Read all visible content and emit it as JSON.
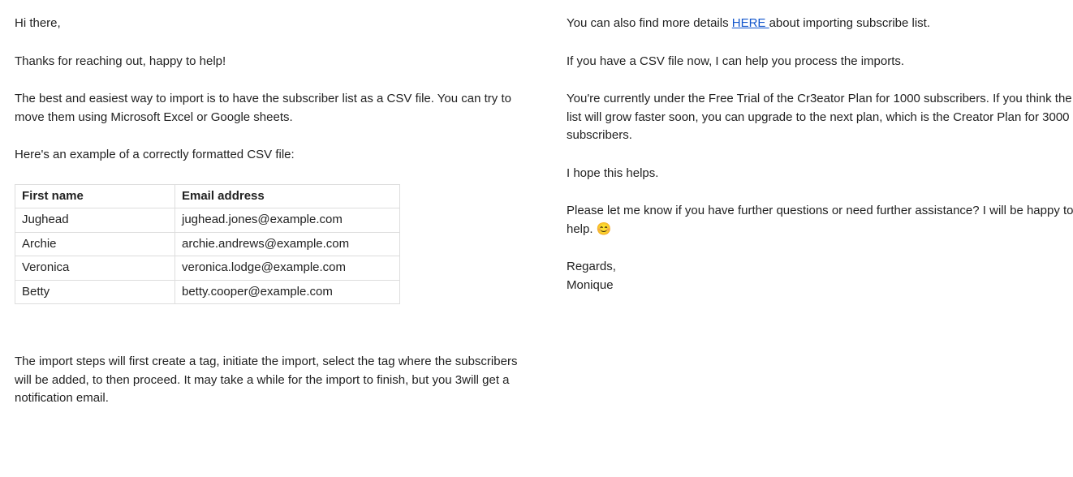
{
  "left": {
    "greeting": "Hi there,",
    "thanks": "Thanks for reaching out, happy to help!",
    "bestway": "The best and easiest way to import is to have the subscriber list as a CSV file. You can try to move them using Microsoft Excel or Google sheets.",
    "example_intro": "Here's an example of a correctly formatted CSV file:",
    "table": {
      "headers": [
        "First name",
        "Email address"
      ],
      "rows": [
        [
          "Jughead",
          "jughead.jones@example.com"
        ],
        [
          "Archie",
          "archie.andrews@example.com"
        ],
        [
          "Veronica",
          "veronica.lodge@example.com"
        ],
        [
          "Betty",
          "betty.cooper@example.com"
        ]
      ]
    },
    "importsteps": "The import steps will first create a tag, initiate the import, select the tag where the subscribers will be added, to then proceed. It may take a while for the import to finish, but you 3will get a notification email."
  },
  "right": {
    "details_pre": "You can also find more details ",
    "details_link": "HERE ",
    "details_post": "about importing subscribe list.",
    "csvhelp": "If you have a CSV file now, I can help you process the imports.",
    "planinfo": "You're currently under the Free Trial of the Cr3eator Plan for 1000 subscribers. If you think the list will grow faster soon, you can upgrade to the next plan, which is the Creator Plan for 3000 subscribers.",
    "hope": "I hope this helps.",
    "closing_text": "Please let me know if you have further questions or need further assistance? I will be happy to help. ",
    "closing_emoji": "😊",
    "regards": "Regards,",
    "signature": "Monique"
  }
}
